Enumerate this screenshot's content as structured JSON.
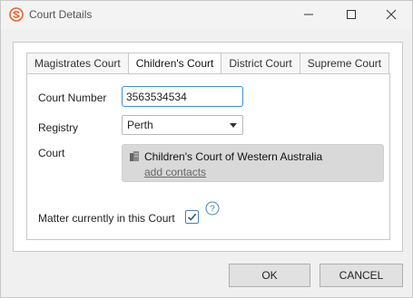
{
  "window": {
    "title": "Court Details",
    "accent": "#e8622e"
  },
  "tabs": [
    {
      "label": "Magistrates Court",
      "active": false
    },
    {
      "label": "Children's Court",
      "active": true
    },
    {
      "label": "District Court",
      "active": false
    },
    {
      "label": "Supreme Court",
      "active": false
    }
  ],
  "form": {
    "court_number_label": "Court Number",
    "court_number_value": "3563534534",
    "registry_label": "Registry",
    "registry_value": "Perth",
    "court_label": "Court",
    "court_name": "Children's Court of Western Australia",
    "add_contacts_label": "add contacts",
    "matter_label": "Matter currently in this Court",
    "matter_checked": true
  },
  "buttons": {
    "ok": "OK",
    "cancel": "CANCEL"
  },
  "icons": {
    "app": "app-logo-icon",
    "minimize": "minimize-icon",
    "maximize": "maximize-icon",
    "close": "close-icon",
    "dropdown": "chevron-down-icon",
    "building": "building-icon",
    "check": "checkmark-icon",
    "help": "help-icon"
  }
}
